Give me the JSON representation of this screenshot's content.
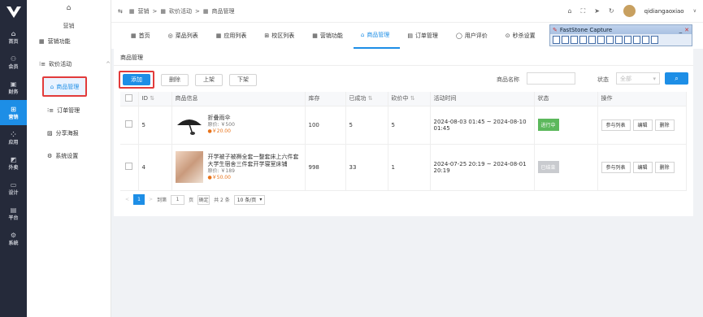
{
  "left_nav": [
    {
      "icon": "⌂",
      "label": "首页"
    },
    {
      "icon": "⚇",
      "label": "会员"
    },
    {
      "icon": "▣",
      "label": "财务"
    },
    {
      "icon": "⊞",
      "label": "营销"
    },
    {
      "icon": "⁘",
      "label": "应用"
    },
    {
      "icon": "◩",
      "label": "外卖"
    },
    {
      "icon": "▭",
      "label": "设计"
    },
    {
      "icon": "▤",
      "label": "平台"
    },
    {
      "icon": "⚙",
      "label": "系统"
    }
  ],
  "sub_nav": {
    "home_icon": "⌂",
    "title": "营销",
    "marketing_func": "营销功能",
    "bargain": "砍价活动",
    "product_mgmt": "商品管理",
    "order_mgmt": "订单管理",
    "share_poster": "分享海报",
    "system_settings": "系统设置"
  },
  "breadcrumb": {
    "items": [
      "营销",
      "砍价活动",
      "商品管理"
    ],
    "sep": ">"
  },
  "user": {
    "name": "qidiangaoxiao"
  },
  "tabs": [
    {
      "icon": "▦",
      "label": "首页"
    },
    {
      "icon": "◎",
      "label": "菜品列表"
    },
    {
      "icon": "▦",
      "label": "应用列表"
    },
    {
      "icon": "⊞",
      "label": "校区列表"
    },
    {
      "icon": "▦",
      "label": "营销功能"
    },
    {
      "icon": "⌂",
      "label": "商品管理"
    },
    {
      "icon": "▤",
      "label": "订单管理"
    },
    {
      "icon": "◯",
      "label": "用户评价"
    },
    {
      "icon": "⊙",
      "label": "秒杀设置"
    }
  ],
  "faststone": {
    "title": "FastStone Capture"
  },
  "panel": {
    "title": "商品管理",
    "buttons": {
      "add": "添加",
      "delete": "删除",
      "on_shelf": "上架",
      "off_shelf": "下架"
    },
    "filter": {
      "name_label": "商品名称",
      "status_label": "状态",
      "status_placeholder": "全部"
    }
  },
  "table": {
    "headers": [
      "ID",
      "商品信息",
      "库存",
      "已成功",
      "砍价中",
      "活动时间",
      "状态",
      "操作"
    ],
    "rows": [
      {
        "id": "5",
        "name": "折叠雨伞",
        "orig_price": "原价: ￥500",
        "bargain_price": "￥20.00",
        "stock": "100",
        "success": "5",
        "bargaining": "5",
        "time": "2024-08-03 01:45 ~ 2024-08-10 01:45",
        "status": "进行中",
        "ops": [
          "参与列表",
          "编辑",
          "删除"
        ]
      },
      {
        "id": "4",
        "name": "开学被子被褥全套一整套床上六件套大学生宿舍三件套开学寝室床铺",
        "orig_price": "原价: ￥189",
        "bargain_price": "￥50.00",
        "stock": "998",
        "success": "33",
        "bargaining": "1",
        "time": "2024-07-25 20:19 ~ 2024-08-01 20:19",
        "status": "已结束",
        "ops": [
          "参与列表",
          "编辑",
          "删除"
        ]
      }
    ]
  },
  "pager": {
    "current": "1",
    "goto_label": "到第",
    "goto_value": "1",
    "page_unit": "页",
    "confirm": "确定",
    "total": "共 2 条",
    "per_page": "10 条/页"
  }
}
